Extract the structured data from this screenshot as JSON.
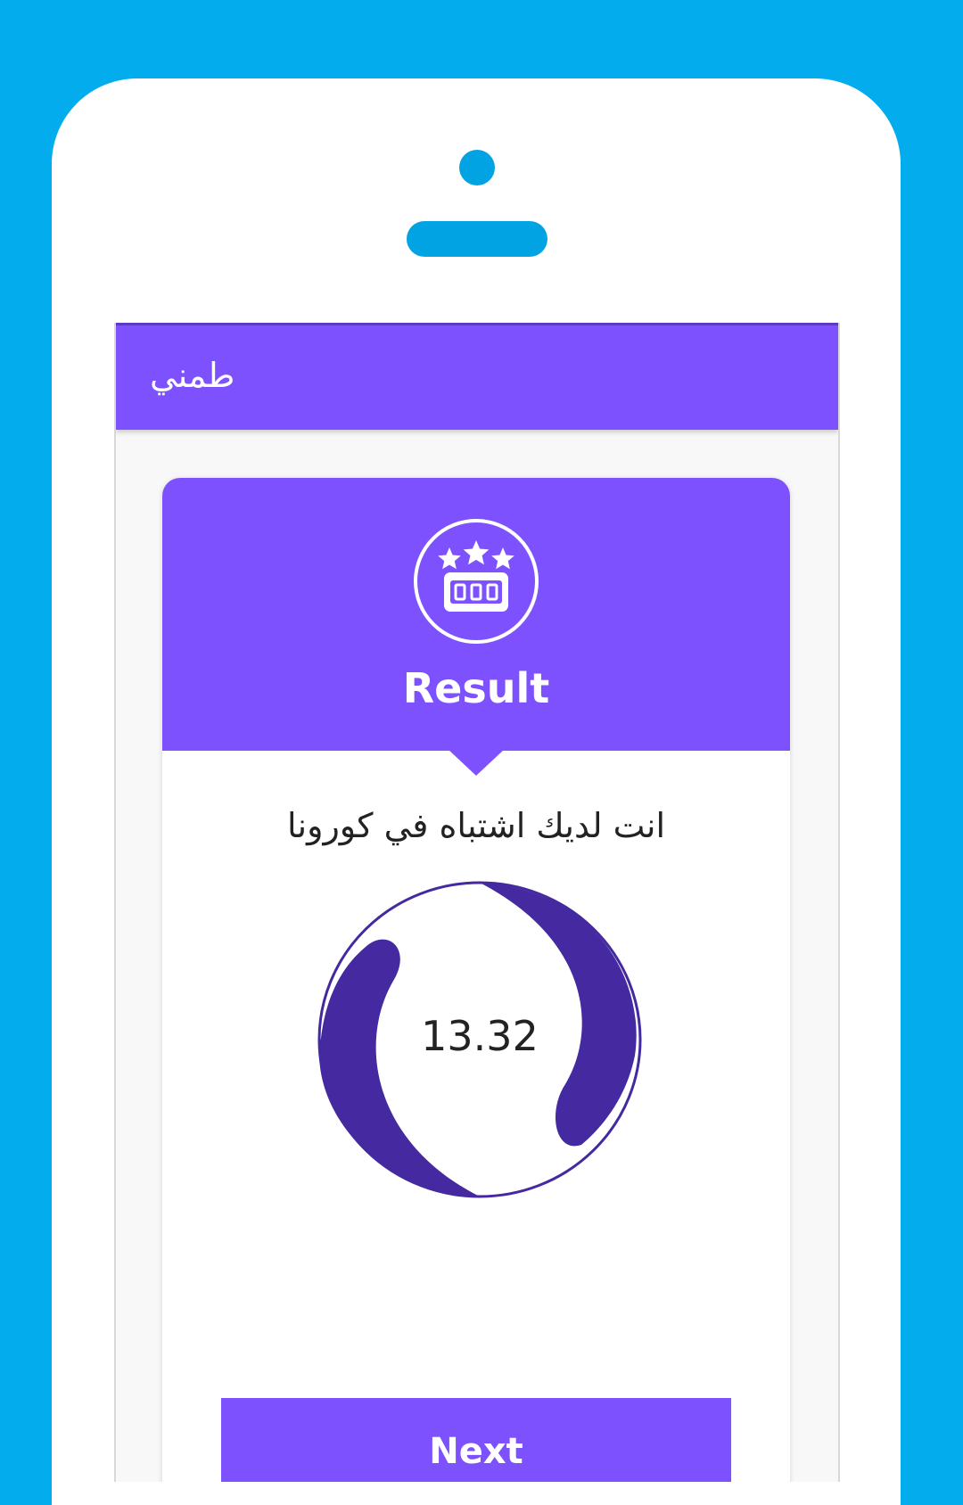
{
  "app": {
    "title": "طمني"
  },
  "result": {
    "icon": "rating-stars-icon",
    "title": "Result",
    "message": "انت لديك اشتباه في كورونا",
    "score": "13.32"
  },
  "actions": {
    "next_label": "Next"
  },
  "colors": {
    "background": "#02aced",
    "primary": "#7d52fe",
    "gauge": "#4429a0",
    "device_accent": "#02a3e2"
  }
}
